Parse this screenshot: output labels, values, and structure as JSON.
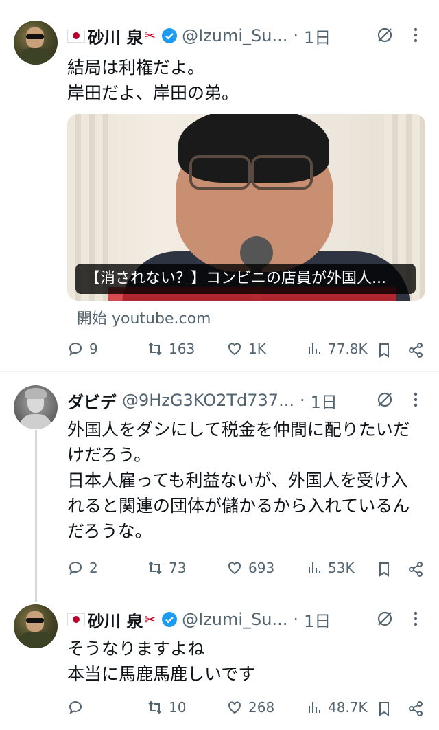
{
  "tweets": [
    {
      "display_name": "砂川 泉",
      "handle": "@Izumi_Su...",
      "separator": "·",
      "time": "1日",
      "text": "結局は利権だよ。\n岸田だよ、岸田の弟。",
      "card": {
        "caption": "【消されない？】コンビニの店員が外国人...",
        "source": "開始 youtube.com"
      },
      "stats": {
        "replies": "9",
        "retweets": "163",
        "likes": "1K",
        "views": "77.8K"
      }
    },
    {
      "display_name": "ダビデ",
      "handle": "@9HzG3KO2Td737...",
      "separator": "·",
      "time": "1日",
      "text": "外国人をダシにして税金を仲間に配りたいだけだろう。\n日本人雇っても利益ないが、外国人を受け入れると関連の団体が儲かるから入れているんだろうな。",
      "stats": {
        "replies": "2",
        "retweets": "73",
        "likes": "693",
        "views": "53K"
      }
    },
    {
      "display_name": "砂川 泉",
      "handle": "@Izumi_Su...",
      "separator": "·",
      "time": "1日",
      "text": "そうなりますよね\n本当に馬鹿馬鹿しいです",
      "stats": {
        "replies": "",
        "retweets": "10",
        "likes": "268",
        "views": "48.7K"
      }
    }
  ],
  "colors": {
    "accent": "#1d9bf0",
    "muted": "#536471",
    "text": "#0f1419",
    "divider": "#eff3f4"
  },
  "icons": [
    "flag-japan-icon",
    "verified-badge-icon",
    "grok-icon",
    "more-icon",
    "reply-icon",
    "retweet-icon",
    "like-icon",
    "views-icon",
    "bookmark-icon",
    "share-icon"
  ]
}
